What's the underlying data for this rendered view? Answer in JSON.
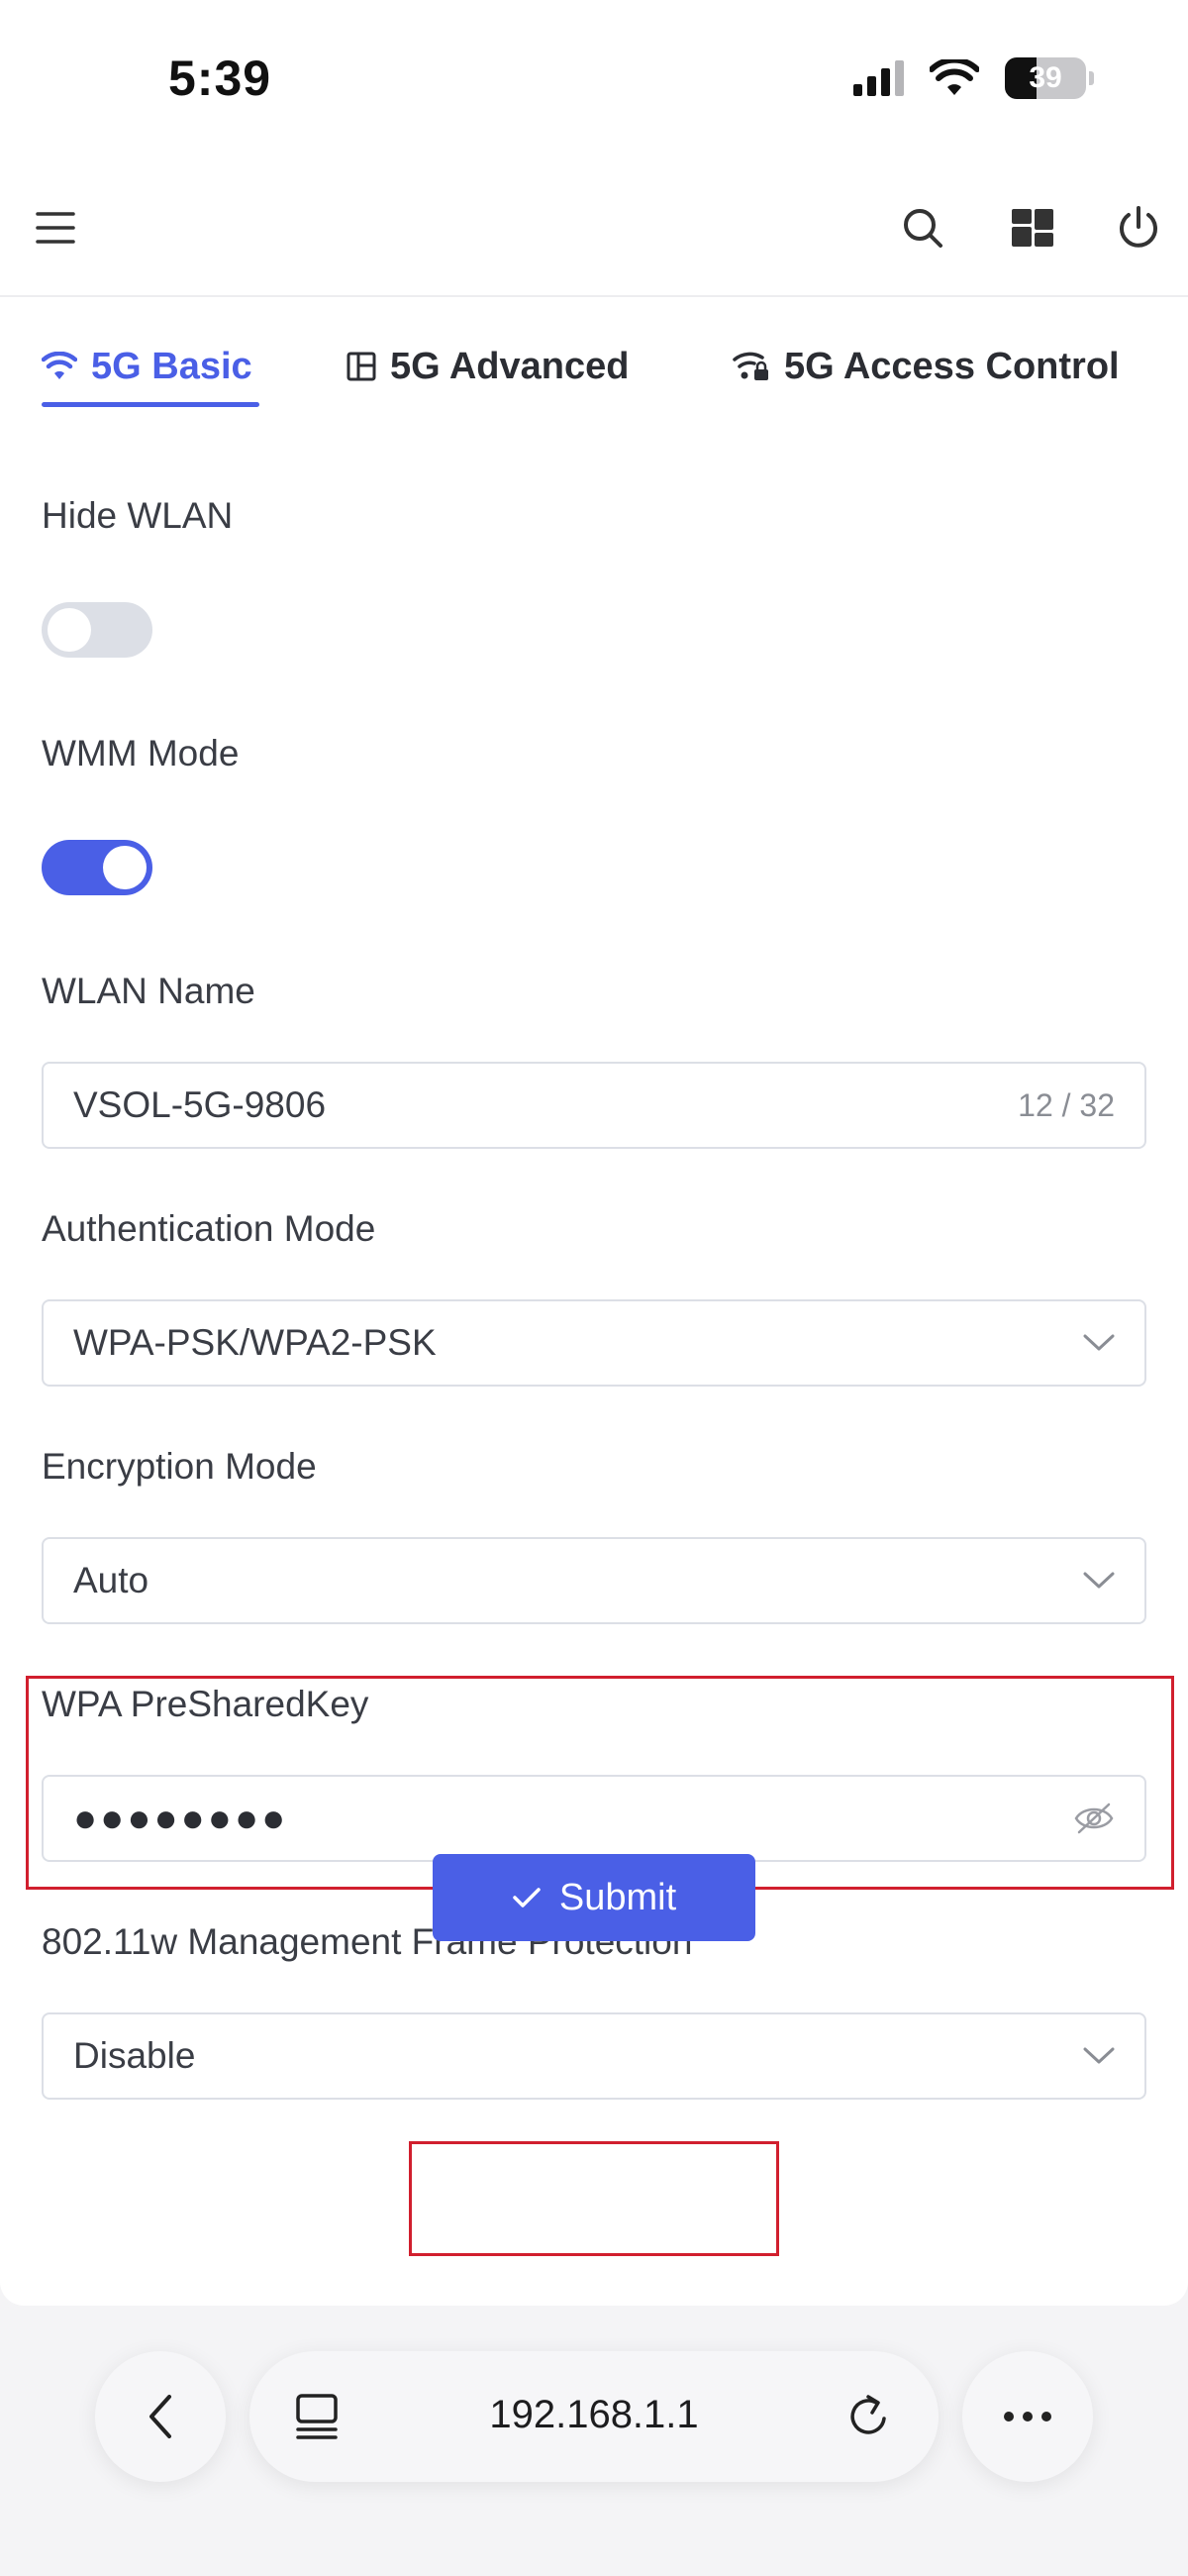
{
  "status_bar": {
    "time": "5:39",
    "battery": "39",
    "battery_level": 0.39
  },
  "tabs": [
    {
      "label": "5G Basic",
      "icon": "wifi-icon",
      "active": true
    },
    {
      "label": "5G Advanced",
      "icon": "grid-icon",
      "active": false
    },
    {
      "label": "5G Access Control",
      "icon": "wifi-lock-icon",
      "active": false
    }
  ],
  "form": {
    "hide_wlan": {
      "label": "Hide WLAN",
      "enabled": false
    },
    "wmm_mode": {
      "label": "WMM Mode",
      "enabled": true
    },
    "wlan_name": {
      "label": "WLAN Name",
      "value": "VSOL-5G-9806",
      "count": "12 / 32"
    },
    "auth_mode": {
      "label": "Authentication Mode",
      "value": "WPA-PSK/WPA2-PSK"
    },
    "encryption_mode": {
      "label": "Encryption Mode",
      "value": "Auto"
    },
    "psk": {
      "label": "WPA PreSharedKey",
      "masked_value": "●●●●●●●●"
    },
    "mfp": {
      "label": "802.11w Management Frame Protection",
      "value": "Disable"
    },
    "submit_label": "Submit"
  },
  "browser": {
    "url": "192.168.1.1"
  },
  "colors": {
    "accent": "#4a5fe6",
    "highlight": "#d11f2e"
  }
}
